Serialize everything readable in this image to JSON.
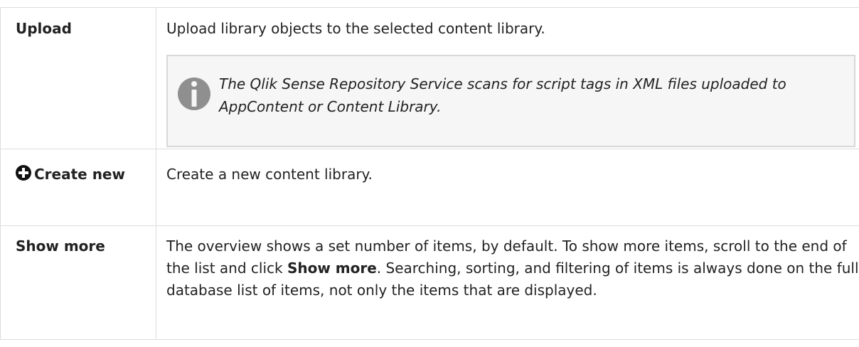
{
  "rows": [
    {
      "term": "Upload",
      "description": "Upload library objects to the selected content library.",
      "note": {
        "icon": "info-icon",
        "text": "The Qlik Sense Repository Service scans for script tags in XML files uploaded to AppContent or Content Library."
      }
    },
    {
      "term_icon": "plus-circle-icon",
      "term": "Create new",
      "description": "Create a new content library."
    },
    {
      "term": "Show more",
      "description_parts": {
        "before": "The overview shows a set number of items, by default. To show more items, scroll to the end of the list and click ",
        "bold": "Show more",
        "after": ". Searching, sorting, and filtering of items is always done on the full database list of items, not only the items that are displayed."
      }
    }
  ],
  "colors": {
    "border": "#dddddd",
    "note_background": "#f6f6f6",
    "note_border": "#d8d8d8",
    "icon_gray": "#8f8f8f",
    "text": "#222222"
  }
}
